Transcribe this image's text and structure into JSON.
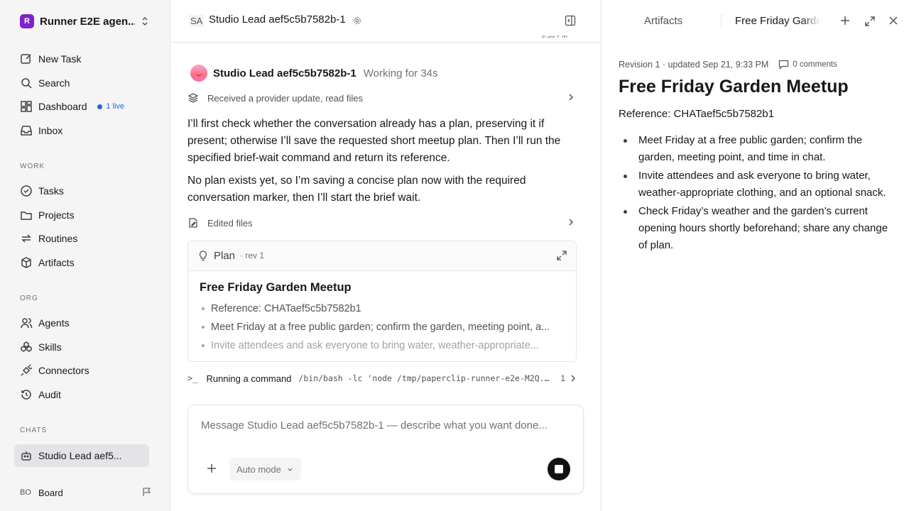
{
  "sidebar": {
    "workspace_initial": "R",
    "workspace_name": "Runner E2E agen...",
    "nav": [
      {
        "label": "New Task"
      },
      {
        "label": "Search"
      },
      {
        "label": "Dashboard",
        "badge": "1 live"
      },
      {
        "label": "Inbox"
      }
    ],
    "work_label": "WORK",
    "work": [
      {
        "label": "Tasks"
      },
      {
        "label": "Projects"
      },
      {
        "label": "Routines"
      },
      {
        "label": "Artifacts"
      }
    ],
    "org_label": "ORG",
    "org": [
      {
        "label": "Agents"
      },
      {
        "label": "Skills"
      },
      {
        "label": "Connectors"
      },
      {
        "label": "Audit"
      }
    ],
    "chats_label": "CHATS",
    "chats": [
      {
        "label": "Studio Lead aef5..."
      }
    ],
    "board_initials": "BO",
    "board_label": "Board"
  },
  "chat": {
    "agent_initials": "SA",
    "title": "Studio Lead aef5c5b7582b-1",
    "scroll_fragment": "9:33 PM",
    "message": {
      "author": "Studio Lead aef5c5b7582b-1",
      "status": "Working for 34s",
      "step1": "Received a provider update, read files",
      "para1": "I’ll first check whether the conversation already has a plan, preserving it if present; otherwise I’ll save the requested short meetup plan. Then I’ll run the specified brief-wait command and return its reference.",
      "para2": "No plan exists yet, so I’m saving a concise plan now with the required conversation marker, then I’ll start the brief wait.",
      "step2": "Edited files"
    },
    "plan": {
      "label": "Plan",
      "rev": "· rev 1",
      "title": "Free Friday Garden Meetup",
      "items": [
        "Reference: CHATaef5c5b7582b1",
        "Meet Friday at a free public garden; confirm the garden, meeting point, a...",
        "Invite attendees and ask everyone to bring water, weather-appropriate..."
      ]
    },
    "command": {
      "label": "Running a command",
      "code": "/bin/bash -lc 'node /tmp/paperclip-runner-e2e-M2Q...",
      "count": "1"
    },
    "composer": {
      "placeholder": "Message Studio Lead aef5c5b7582b-1 — describe what you want done...",
      "mode": "Auto mode"
    }
  },
  "artifact_panel": {
    "tab_artifacts": "Artifacts",
    "tab_current": "Free Friday Garden Meetup",
    "meta": "Revision 1 · updated Sep 21, 9:33 PM",
    "comments": "0 comments",
    "title": "Free Friday Garden Meetup",
    "reference": "Reference: CHATaef5c5b7582b1",
    "items": [
      "Meet Friday at a free public garden; confirm the garden, meeting point, and time in chat.",
      "Invite attendees and ask everyone to bring water, weather-appropriate clothing, and an optional snack.",
      "Check Friday’s weather and the garden’s current opening hours shortly beforehand; share any change of plan."
    ]
  },
  "colors": {
    "accent_live": "#2563eb",
    "workspace_logo": "#7e22ce",
    "sidebar_bg": "#f5f5f5"
  }
}
